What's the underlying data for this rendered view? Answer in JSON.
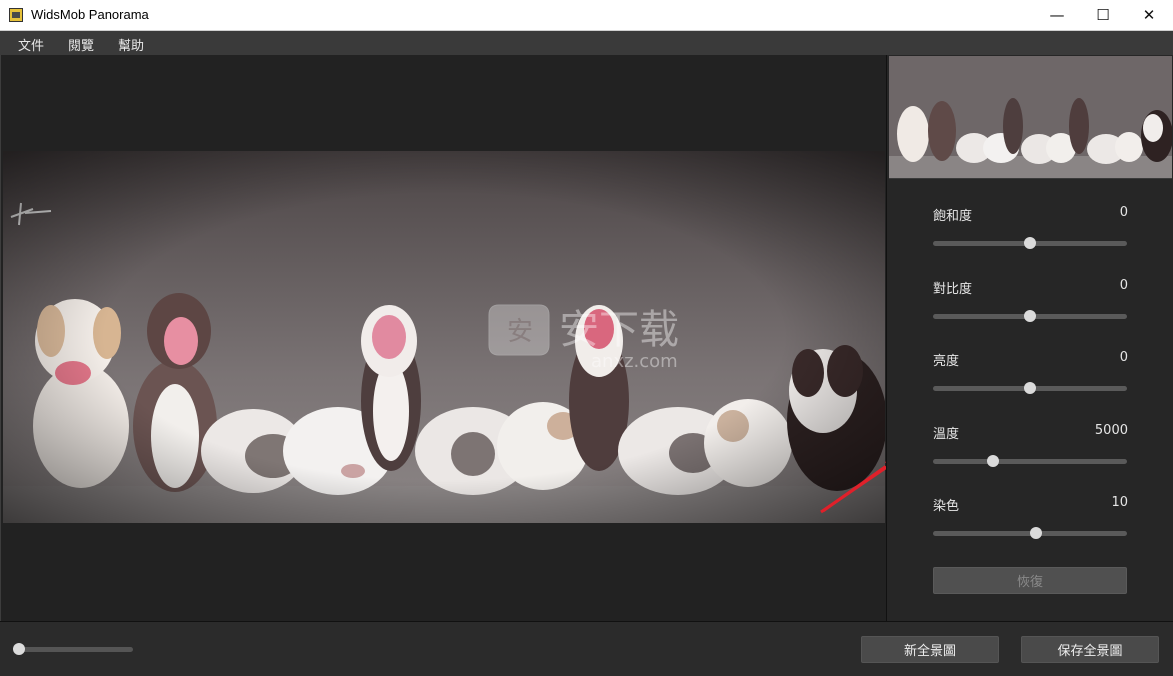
{
  "window": {
    "title": "WidsMob Panorama",
    "minimize": "—",
    "maximize": "☐",
    "close": "✕"
  },
  "menu": {
    "items": [
      "文件",
      "閱覽",
      "幫助"
    ]
  },
  "adjustments": [
    {
      "label": "飽和度",
      "value": "0",
      "level": 0.5
    },
    {
      "label": "對比度",
      "value": "0",
      "level": 0.5
    },
    {
      "label": "亮度",
      "value": "0",
      "level": 0.5
    },
    {
      "label": "溫度",
      "value": "5000",
      "level": 0.31
    },
    {
      "label": "染色",
      "value": "10",
      "level": 0.53
    }
  ],
  "reset_label": "恢復",
  "zoom_level": 0.04,
  "buttons": {
    "new_panorama": "新全景圖",
    "save_panorama": "保存全景圖"
  },
  "watermark": {
    "text": "安下载",
    "sub": "anxz.com"
  },
  "colors": {
    "accent_arrow": "#e0202a",
    "background": "#222222",
    "panel": "#262626"
  }
}
